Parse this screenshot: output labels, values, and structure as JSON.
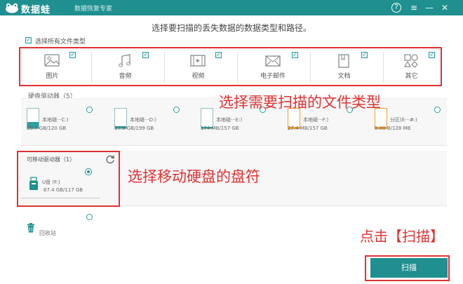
{
  "app": {
    "name": "数据蛙",
    "subtitle": "数据恢复专家"
  },
  "window_controls": {
    "help": "?",
    "menu": "≡",
    "minimize": "—",
    "close": "✕"
  },
  "heading": "选择要扫描的丢失数据的数据类型和路径。",
  "select_all": {
    "label": "选择所有文件类型",
    "checked": true,
    "mark": "✓"
  },
  "file_types": [
    {
      "label": "图片",
      "icon": "image-icon",
      "checked": true
    },
    {
      "label": "音频",
      "icon": "music-icon",
      "checked": true
    },
    {
      "label": "视频",
      "icon": "video-icon",
      "checked": true
    },
    {
      "label": "电子邮件",
      "icon": "mail-icon",
      "checked": true
    },
    {
      "label": "文档",
      "icon": "document-icon",
      "checked": true
    },
    {
      "label": "其它",
      "icon": "other-icon",
      "checked": true
    }
  ],
  "hard_drives": {
    "label": "硬盘驱动器（5）",
    "drives": [
      {
        "name": "本地磁···C:)",
        "size": "39.7 GB/120 GB",
        "used": 0.33
      },
      {
        "name": "本地磁···D:)",
        "size": "17.9 GB/199 GB",
        "used": 0.09
      },
      {
        "name": "本地磁···E:)",
        "size": "174 MB/157 GB",
        "used": 0.01
      },
      {
        "name": "本地磁···F:)",
        "size": "27.4 MB/157 GB",
        "used": 0.01
      },
      {
        "name": "分区(E···#:)",
        "size": "0.00  B/128 MB",
        "used": 0
      }
    ]
  },
  "removable": {
    "label": "可移动驱动器（1）",
    "drive": {
      "name": "U盘 (F:)",
      "size": "67.4 GB/117 GB",
      "selected": true
    }
  },
  "recycle_bin": "回收站",
  "annotations": {
    "select_types": "选择需要扫描的文件类型",
    "select_drive": "选择移动硬盘的盘符",
    "click_scan": "点击【扫描】"
  },
  "scan_button": "扫描",
  "colors": {
    "accent": "#1f8f8f",
    "annotation": "#e03232",
    "drive_fill_teal": "#2aa0a0",
    "drive_fill_orange": "#f0a030"
  }
}
